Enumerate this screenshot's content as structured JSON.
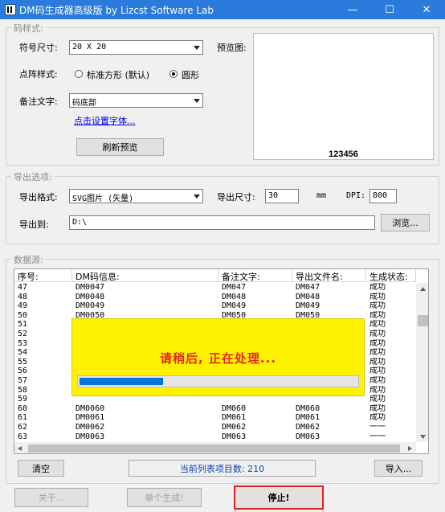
{
  "window": {
    "title": "DM码生成器高级版  by Lizcst Software Lab",
    "minimize": "—",
    "maximize": "☐",
    "close": "✕"
  },
  "code_style": {
    "legend": "码样式:",
    "symbol_size_label": "符号尺寸:",
    "symbol_size_value": "20 X 20",
    "dot_style_label": "点阵样式:",
    "dot_option_square": "标准方形 (默认)",
    "dot_option_circle": "圆形",
    "dot_selected": "circle",
    "note_label": "备注文字:",
    "note_value": "码底部",
    "font_link": "点击设置字体...",
    "refresh_button": "刷新预览",
    "preview_label": "预览图:",
    "preview_code_text": "123456"
  },
  "export": {
    "legend": "导出选项:",
    "format_label": "导出格式:",
    "format_value": "SVG图片 (矢量)",
    "size_label": "导出尺寸:",
    "size_value": "30",
    "size_unit": "mm",
    "dpi_label": "DPI:",
    "dpi_value": "800",
    "path_label": "导出到:",
    "path_value": "D:\\",
    "browse_button": "浏览..."
  },
  "datasource": {
    "legend": "数据源:",
    "columns": [
      "序号:",
      "DM码信息:",
      "备注文字:",
      "导出文件名:",
      "生成状态:"
    ],
    "rows": [
      [
        "47",
        "DM0047",
        "DM047",
        "DM047",
        "成功"
      ],
      [
        "48",
        "DM0048",
        "DM048",
        "DM048",
        "成功"
      ],
      [
        "49",
        "DM0049",
        "DM049",
        "DM049",
        "成功"
      ],
      [
        "50",
        "DM0050",
        "DM050",
        "DM050",
        "成功"
      ],
      [
        "51",
        "",
        "",
        "",
        "成功"
      ],
      [
        "52",
        "",
        "",
        "",
        "成功"
      ],
      [
        "53",
        "",
        "",
        "",
        "成功"
      ],
      [
        "54",
        "",
        "",
        "",
        "成功"
      ],
      [
        "55",
        "",
        "",
        "",
        "成功"
      ],
      [
        "56",
        "",
        "",
        "",
        "成功"
      ],
      [
        "57",
        "",
        "",
        "",
        "成功"
      ],
      [
        "58",
        "",
        "",
        "",
        "成功"
      ],
      [
        "59",
        "",
        "",
        "",
        "成功"
      ],
      [
        "60",
        "DM0060",
        "DM060",
        "DM060",
        "成功"
      ],
      [
        "61",
        "DM0061",
        "DM061",
        "DM061",
        "成功"
      ],
      [
        "62",
        "DM0062",
        "DM062",
        "DM062",
        "一一"
      ],
      [
        "63",
        "DM0063",
        "DM063",
        "DM063",
        "一一"
      ]
    ],
    "processing_message": "请稍后, 正在处理...",
    "progress_fraction": 0.3,
    "clear_button": "清空",
    "count_text": "当前列表项目数: 210",
    "import_button": "导入..."
  },
  "footer": {
    "about_button": "关于...",
    "single_button": "单个生成!",
    "stop_button": "停止!"
  },
  "colors": {
    "titlebar": "#2b7bdc",
    "overlay": "#fff200",
    "overlay_text": "#e0281c",
    "progress": "#0674d8",
    "stop_border": "#e02020"
  }
}
